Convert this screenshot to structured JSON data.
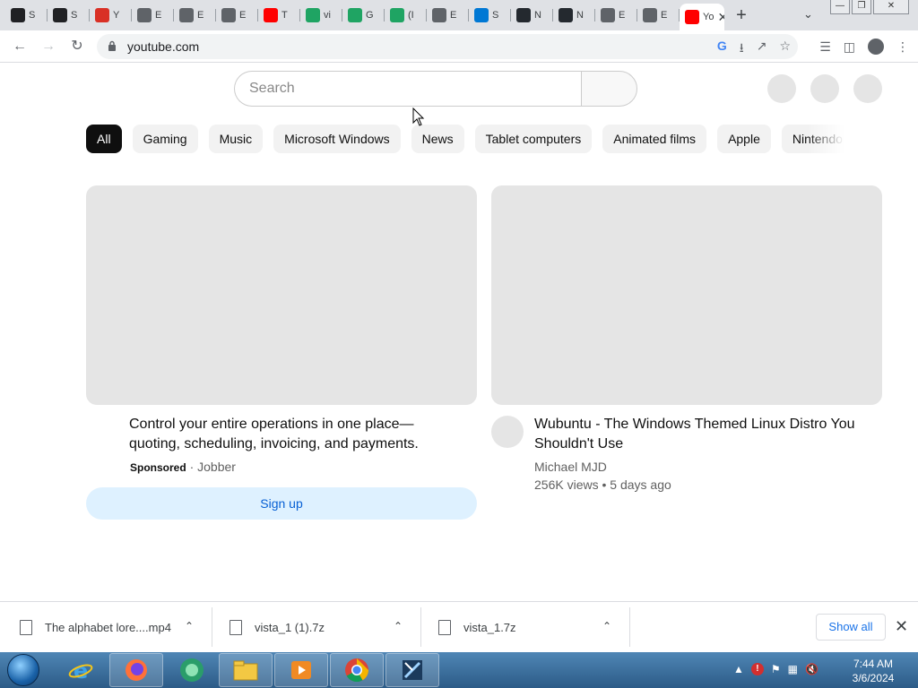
{
  "browser": {
    "tabs": [
      {
        "label": "S",
        "icon": "columns-icon",
        "color": "#202124"
      },
      {
        "label": "S",
        "icon": "columns-icon",
        "color": "#202124"
      },
      {
        "label": "Y",
        "icon": "download-icon",
        "color": "#d93025"
      },
      {
        "label": "E",
        "icon": "globe-icon",
        "color": "#5f6368"
      },
      {
        "label": "E",
        "icon": "globe-icon",
        "color": "#5f6368"
      },
      {
        "label": "E",
        "icon": "globe-icon",
        "color": "#5f6368"
      },
      {
        "label": "T",
        "icon": "youtube-icon",
        "color": "#ff0000"
      },
      {
        "label": "vi",
        "icon": "drive-icon",
        "color": "#1fa463"
      },
      {
        "label": "G",
        "icon": "drive-icon",
        "color": "#1fa463"
      },
      {
        "label": "(I",
        "icon": "drive-icon",
        "color": "#1fa463"
      },
      {
        "label": "E",
        "icon": "globe-icon",
        "color": "#5f6368"
      },
      {
        "label": "S",
        "icon": "edge-icon",
        "color": "#0078d4"
      },
      {
        "label": "N",
        "icon": "github-icon",
        "color": "#24292f"
      },
      {
        "label": "N",
        "icon": "github-icon",
        "color": "#24292f"
      },
      {
        "label": "E",
        "icon": "globe-icon",
        "color": "#5f6368"
      },
      {
        "label": "E",
        "icon": "globe-icon",
        "color": "#5f6368"
      },
      {
        "label": "Yo",
        "icon": "youtube-icon",
        "color": "#ff0000",
        "active": true
      }
    ],
    "new_tab": "+",
    "url": "youtube.com"
  },
  "youtube": {
    "search_placeholder": "Search",
    "chips": [
      "All",
      "Gaming",
      "Music",
      "Microsoft Windows",
      "News",
      "Tablet computers",
      "Animated films",
      "Apple",
      "Nintendo"
    ],
    "ad": {
      "title_line1": "Control your entire operations in one place—",
      "title_line2": "quoting, scheduling, invoicing, and payments.",
      "sponsored": "Sponsored",
      "dot": "·",
      "advertiser": "Jobber",
      "cta": "Sign up"
    },
    "video": {
      "title_line1": "Wubuntu - The Windows Themed Linux Distro You",
      "title_line2": "Shouldn't Use",
      "channel": "Michael MJD",
      "views": "256K views",
      "dot": "•",
      "age": "5 days ago"
    }
  },
  "downloads": {
    "items": [
      {
        "name": "The alphabet lore....mp4"
      },
      {
        "name": "vista_1 (1).7z"
      },
      {
        "name": "vista_1.7z"
      }
    ],
    "show_all": "Show all"
  },
  "taskbar": {
    "time": "7:44 AM",
    "date": "3/6/2024"
  }
}
